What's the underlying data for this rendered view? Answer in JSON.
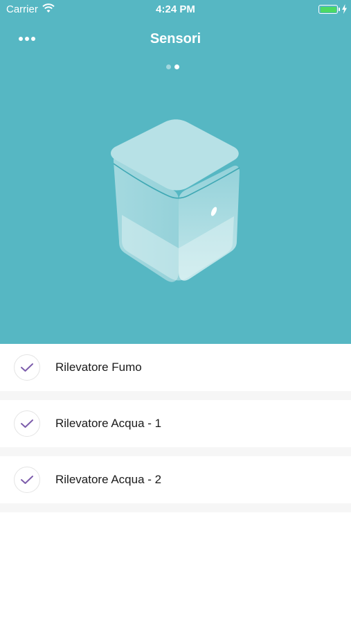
{
  "status_bar": {
    "carrier": "Carrier",
    "time": "4:24 PM",
    "battery_color": "#4cd964"
  },
  "nav": {
    "title": "Sensori",
    "menu_icon": "more-horizontal-icon"
  },
  "pager": {
    "page_count": 2,
    "current_page": 2
  },
  "hero": {
    "background": "#56b7c3",
    "illustration": "sensor-cube-icon"
  },
  "sensors": [
    {
      "label": "Rilevatore Fumo",
      "checked": true
    },
    {
      "label": "Rilevatore Acqua - 1",
      "checked": true
    },
    {
      "label": "Rilevatore Acqua - 2",
      "checked": true
    }
  ],
  "accent_color": "#7c5cab"
}
